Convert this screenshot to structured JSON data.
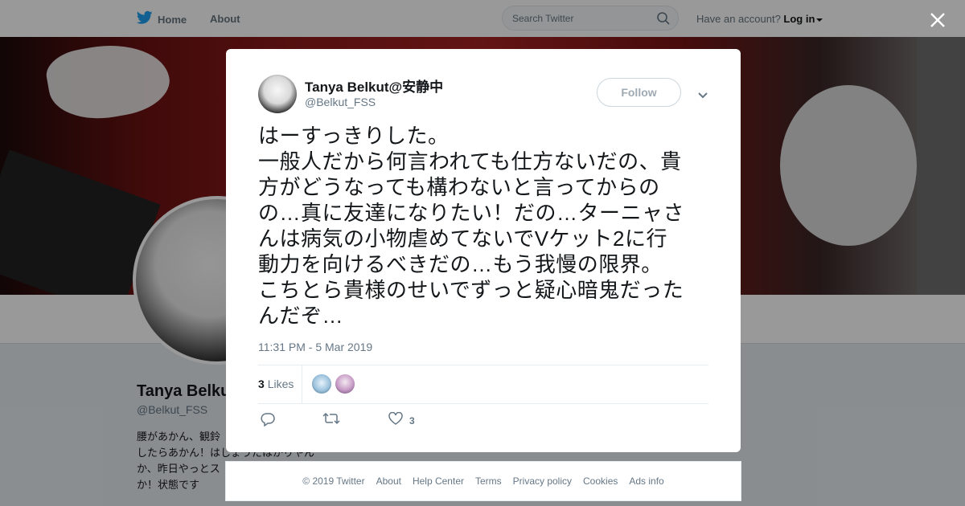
{
  "nav": {
    "home_label": "Home",
    "about_label": "About",
    "search_placeholder": "Search Twitter",
    "account_prompt": "Have an account?",
    "login_label": "Log in"
  },
  "background_profile": {
    "name": "Tanya Belkut",
    "handle": "@Belkut_FSS",
    "bio_lines": [
      "腰があかん、観鈴",
      "したらあかん！はしょうたはかりやん",
      "か、昨日やっとス",
      "か！状態です"
    ]
  },
  "tweet": {
    "author_name": "Tanya Belkut@安静中",
    "author_handle": "@Belkut_FSS",
    "follow_label": "Follow",
    "text_lines": [
      "はーすっきりした。",
      "一般人だから何言われても仕方ないだの、貴",
      "方がどうなっても構わないと言ってからの",
      "の…真に友達になりたい！だの…ターニャさ",
      "んは病気の小物虐めてないでVケット2に行",
      "動力を向けるべきだの…もう我慢の限界。",
      "こちとら貴様のせいでずっと疑心暗鬼だった",
      "んだぞ…"
    ],
    "timestamp": "11:31 PM - 5 Mar 2019",
    "likes_count": "3",
    "likes_label": "Likes",
    "like_action_count": "3"
  },
  "footer": {
    "links": [
      "© 2019 Twitter",
      "About",
      "Help Center",
      "Terms",
      "Privacy policy",
      "Cookies",
      "Ads info"
    ]
  },
  "colors": {
    "twitter_blue": "#1da1f2",
    "text_primary": "#14171a",
    "text_secondary": "#657786"
  },
  "icons": {
    "brand": "twitter-bird-icon",
    "search": "search-icon",
    "close": "close-icon",
    "menu": "chevron-down-icon",
    "reply": "reply-icon",
    "retweet": "retweet-icon",
    "like": "heart-icon"
  }
}
